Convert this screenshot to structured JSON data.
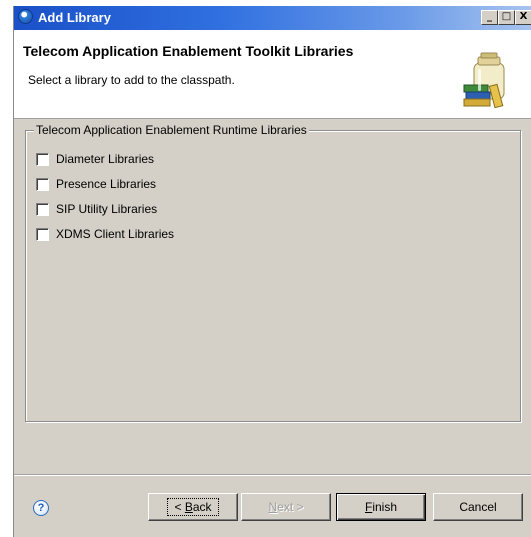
{
  "window": {
    "title": "Add Library",
    "minimize": "_",
    "maximize": "□",
    "close": "X"
  },
  "header": {
    "title": "Telecom Application Enablement Toolkit Libraries",
    "description": "Select a library to add to the classpath.",
    "icon": "library-jar-icon"
  },
  "group": {
    "label": "Telecom Application Enablement Runtime Libraries",
    "items": [
      {
        "label": "Diameter Libraries",
        "checked": false
      },
      {
        "label": "Presence Libraries",
        "checked": false
      },
      {
        "label": "SIP Utility Libraries",
        "checked": false
      },
      {
        "label": "XDMS Client Libraries",
        "checked": false
      }
    ]
  },
  "buttons": {
    "help": "?",
    "back_prefix": "< ",
    "back_mnemonic": "B",
    "back_rest": "ack",
    "next_mnemonic": "N",
    "next_rest": "ext >",
    "finish_mnemonic": "F",
    "finish_rest": "inish",
    "cancel": "Cancel"
  }
}
